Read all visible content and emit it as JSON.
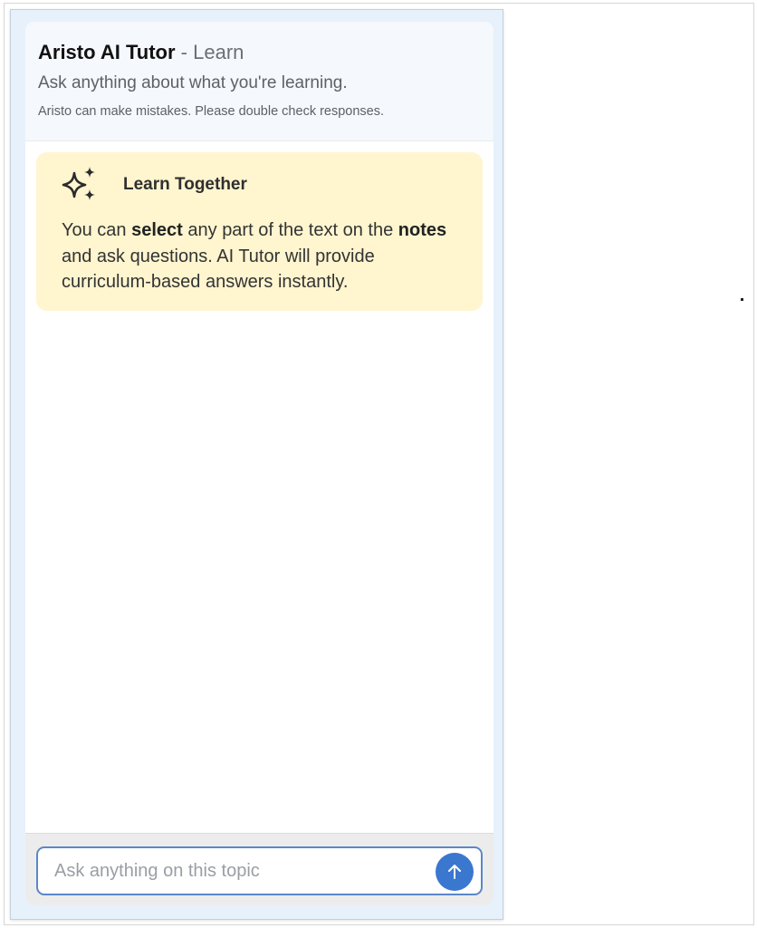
{
  "header": {
    "app_name": "Aristo AI Tutor",
    "separator": " - ",
    "mode": "Learn",
    "subtitle": "Ask anything about what you're learning.",
    "disclaimer": "Aristo can make mistakes. Please double check responses."
  },
  "info_card": {
    "icon": "sparkles-icon",
    "title": "Learn Together",
    "text_parts": {
      "p1": "You can ",
      "b1": "select",
      "p2": " any part of the text on the ",
      "b2": "notes",
      "p3": " and ask questions. AI Tutor will provide curriculum-based answers instantly."
    },
    "background_color": "#fff5cf"
  },
  "composer": {
    "placeholder": "Ask anything on this topic",
    "value": "",
    "send_icon": "arrow-up-icon",
    "accent_color": "#3a77cf"
  }
}
